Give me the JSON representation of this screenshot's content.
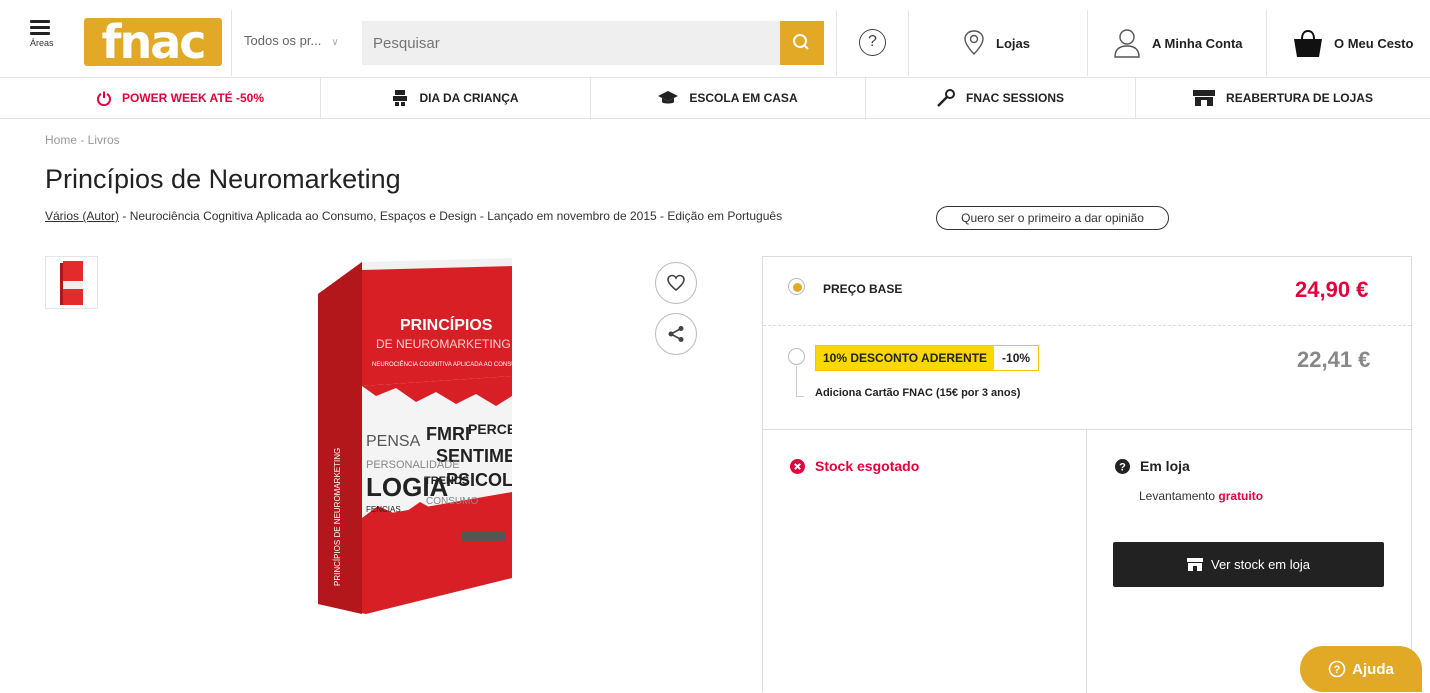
{
  "header": {
    "areas_label": "Áreas",
    "logo_text": "fnac",
    "category_select": "Todos os pr...",
    "search_placeholder": "Pesquisar",
    "stores_label": "Lojas",
    "account_label": "A Minha Conta",
    "basket_label": "O Meu Cesto",
    "help_glyph": "?"
  },
  "nav": {
    "items": [
      {
        "label": "POWER WEEK ATÉ -50%",
        "icon": "power-icon"
      },
      {
        "label": "DIA DA CRIANÇA",
        "icon": "toy-icon"
      },
      {
        "label": "ESCOLA EM CASA",
        "icon": "graduation-cap-icon"
      },
      {
        "label": "FNAC SESSIONS",
        "icon": "microphone-icon"
      },
      {
        "label": "REABERTURA DE LOJAS",
        "icon": "store-icon"
      }
    ]
  },
  "product": {
    "breadcrumb": "Home - Livros",
    "title": "Princípios de Neuromarketing",
    "author": "Vários (Autor)",
    "meta_rest": " - Neurociência Cognitiva Aplicada ao Consumo, Espaços e Design - Lançado em novembro de 2015 - Edição em Português",
    "opinion_button": "Quero ser o primeiro a dar opinião",
    "cover": {
      "title_line1": "PRINCÍPIOS",
      "title_line2": "DE NEUROMARKETING",
      "subtitle": "NEUROCIÊNCIA COGNITIVA APLICADA AO CONSUMO, ESPAÇOS E DESIGN",
      "spine": "PRINCÍPIOS DE NEUROMARKETING",
      "word_cloud": [
        "PENSA",
        "FMRI",
        "PERCE",
        "SENTIME",
        "LOGIA",
        "TRENDS",
        "PSICOLO",
        "PERSONALIDADE",
        "CONSUMO",
        "FENCIAS"
      ]
    }
  },
  "pricing": {
    "base_label": "PREÇO BASE",
    "base_price": "24,90 €",
    "promo_label": "10% DESCONTO ADERENTE",
    "promo_percent": "-10%",
    "promo_price": "22,41 €",
    "promo_note": "Adiciona Cartão FNAC (15€ por 3 anos)"
  },
  "availability": {
    "stock_status": "Stock esgotado",
    "store_label": "Em loja",
    "pickup_text": "Levantamento ",
    "pickup_free": "gratuito",
    "stock_button": "Ver stock em loja"
  },
  "chat": {
    "label": "Ajuda"
  },
  "colors": {
    "brand": "#e1a925",
    "red": "#e4003c",
    "promo_yellow": "#f9d800",
    "dark": "#222222"
  }
}
